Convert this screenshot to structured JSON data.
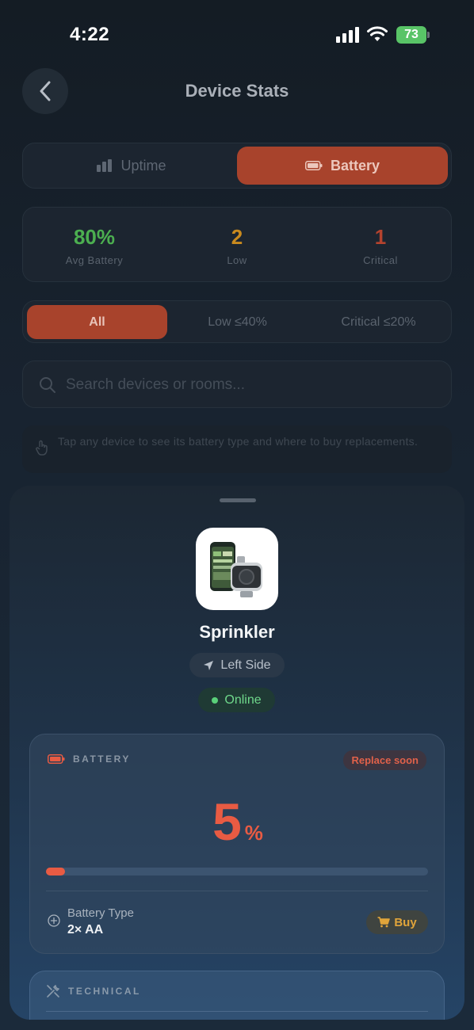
{
  "status_bar": {
    "time": "4:22",
    "battery_level": "73"
  },
  "header": {
    "title": "Device Stats",
    "back_icon": "chevron-left-icon"
  },
  "segments": {
    "uptime_label": "Uptime",
    "battery_label": "Battery",
    "active": "Battery"
  },
  "summary": {
    "avg_value": "80%",
    "avg_label": "Avg Battery",
    "low_value": "2",
    "low_label": "Low",
    "critical_value": "1",
    "critical_label": "Critical"
  },
  "filters": {
    "all": "All",
    "low": "Low ≤40%",
    "critical": "Critical ≤20%",
    "active": "All"
  },
  "search": {
    "placeholder": "Search devices or rooms...",
    "value": ""
  },
  "tip": {
    "text": "Tap any device to see its battery type and where to buy replacements."
  },
  "device": {
    "name": "Sprinkler",
    "location": "Left Side",
    "status": "Online",
    "battery": {
      "section_label": "BATTERY",
      "badge": "Replace soon",
      "percent": "5",
      "percent_unit": "%",
      "level_fraction": 0.05,
      "type_label": "Battery Type",
      "type_value": "2× AA",
      "buy_label": "Buy"
    },
    "technical": {
      "section_label": "TECHNICAL"
    }
  },
  "colors": {
    "accent": "#a8432c",
    "avg_green": "#4caf50",
    "low_orange": "#c98a1e",
    "critical_red": "#b4432e",
    "percent_red": "#e85b43",
    "online_green": "#6fd88b"
  }
}
